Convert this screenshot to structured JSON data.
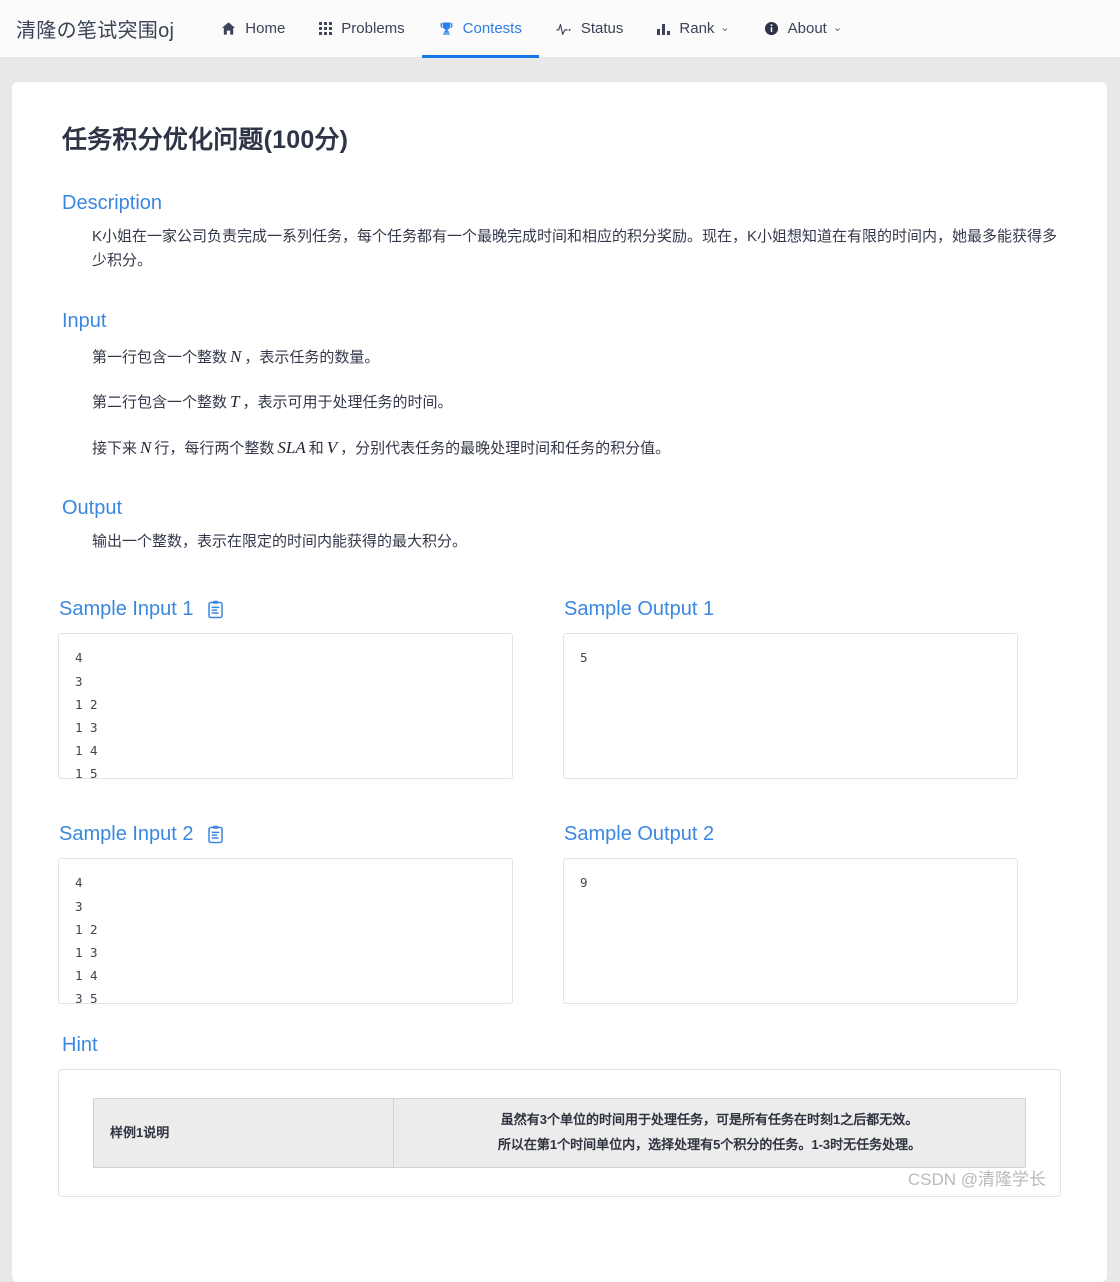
{
  "navbar": {
    "brand": "清隆の笔试突围oj",
    "items": [
      {
        "label": "Home",
        "icon": "home-icon",
        "active": false,
        "caret": ""
      },
      {
        "label": "Problems",
        "icon": "grid-icon",
        "active": false,
        "caret": ""
      },
      {
        "label": "Contests",
        "icon": "trophy-icon",
        "active": true,
        "caret": ""
      },
      {
        "label": "Status",
        "icon": "activity-icon",
        "active": false,
        "caret": ""
      },
      {
        "label": "Rank",
        "icon": "bar-chart-icon",
        "active": false,
        "caret": "⌄"
      },
      {
        "label": "About",
        "icon": "info-icon",
        "active": false,
        "caret": "⌄"
      }
    ],
    "active_color": "#2b7de9"
  },
  "problem": {
    "title": "任务积分优化问题(100分)",
    "description": {
      "heading": "Description",
      "text": "K小姐在一家公司负责完成一系列任务，每个任务都有一个最晚完成时间和相应的积分奖励。现在，K小姐想知道在有限的时间内，她最多能获得多少积分。"
    },
    "input": {
      "heading": "Input",
      "line1_a": "第一行包含一个整数",
      "line1_var": "N",
      "line1_b": "，表示任务的数量。",
      "line2_a": "第二行包含一个整数",
      "line2_var": "T",
      "line2_b": "，表示可用于处理任务的时间。",
      "line3_a": "接下来",
      "line3_var1": "N",
      "line3_b": "行，每行两个整数",
      "line3_var2": "SLA",
      "line3_c": "和",
      "line3_var3": "V",
      "line3_d": "，分别代表任务的最晚处理时间和任务的积分值。"
    },
    "output": {
      "heading": "Output",
      "text": "输出一个整数，表示在限定的时间内能获得的最大积分。"
    },
    "samples": [
      {
        "input_heading": "Sample Input 1",
        "output_heading": "Sample Output 1",
        "input_text": "4\n3\n1 2\n1 3\n1 4\n1 5",
        "output_text": "5",
        "copy_icon": "clipboard-icon"
      },
      {
        "input_heading": "Sample Input 2",
        "output_heading": "Sample Output 2",
        "input_text": "4\n3\n1 2\n1 3\n1 4\n3 5",
        "output_text": "9",
        "copy_icon": "clipboard-icon"
      }
    ],
    "hint": {
      "heading": "Hint",
      "rows": [
        {
          "label": "样例1说明",
          "line1": "虽然有3个单位的时间用于处理任务，可是所有任务在时刻1之后都无效。",
          "line2": "所以在第1个时间单位内，选择处理有5个积分的任务。1-3时无任务处理。"
        }
      ]
    }
  },
  "watermark": "CSDN @清隆学长"
}
